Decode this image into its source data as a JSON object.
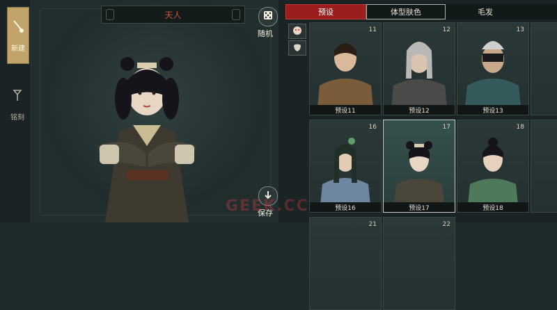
{
  "side_nav": {
    "items": [
      {
        "label": "新建",
        "icon": "brush-icon",
        "active": true
      },
      {
        "label": "铭刻",
        "icon": "seal-icon",
        "active": false
      }
    ]
  },
  "stage": {
    "name_plate": "天人",
    "random_label": "随机",
    "save_label": "保存"
  },
  "tabs": [
    {
      "label": "预设",
      "state": "active"
    },
    {
      "label": "体型肤色",
      "state": "outline"
    },
    {
      "label": "毛发",
      "state": "normal"
    }
  ],
  "presets": [
    {
      "num": "11",
      "label": "预设11"
    },
    {
      "num": "12",
      "label": "预设12"
    },
    {
      "num": "13",
      "label": "预设13"
    },
    {
      "num": "16",
      "label": "预设16"
    },
    {
      "num": "17",
      "label": "预设17"
    },
    {
      "num": "18",
      "label": "预设18"
    },
    {
      "num": "21",
      "label": ""
    },
    {
      "num": "22",
      "label": ""
    }
  ],
  "watermark": "GEEK.CC",
  "colors": {
    "accent_red": "#9b1e1e",
    "gold": "#c2a46a",
    "name_red": "#c8523b"
  }
}
